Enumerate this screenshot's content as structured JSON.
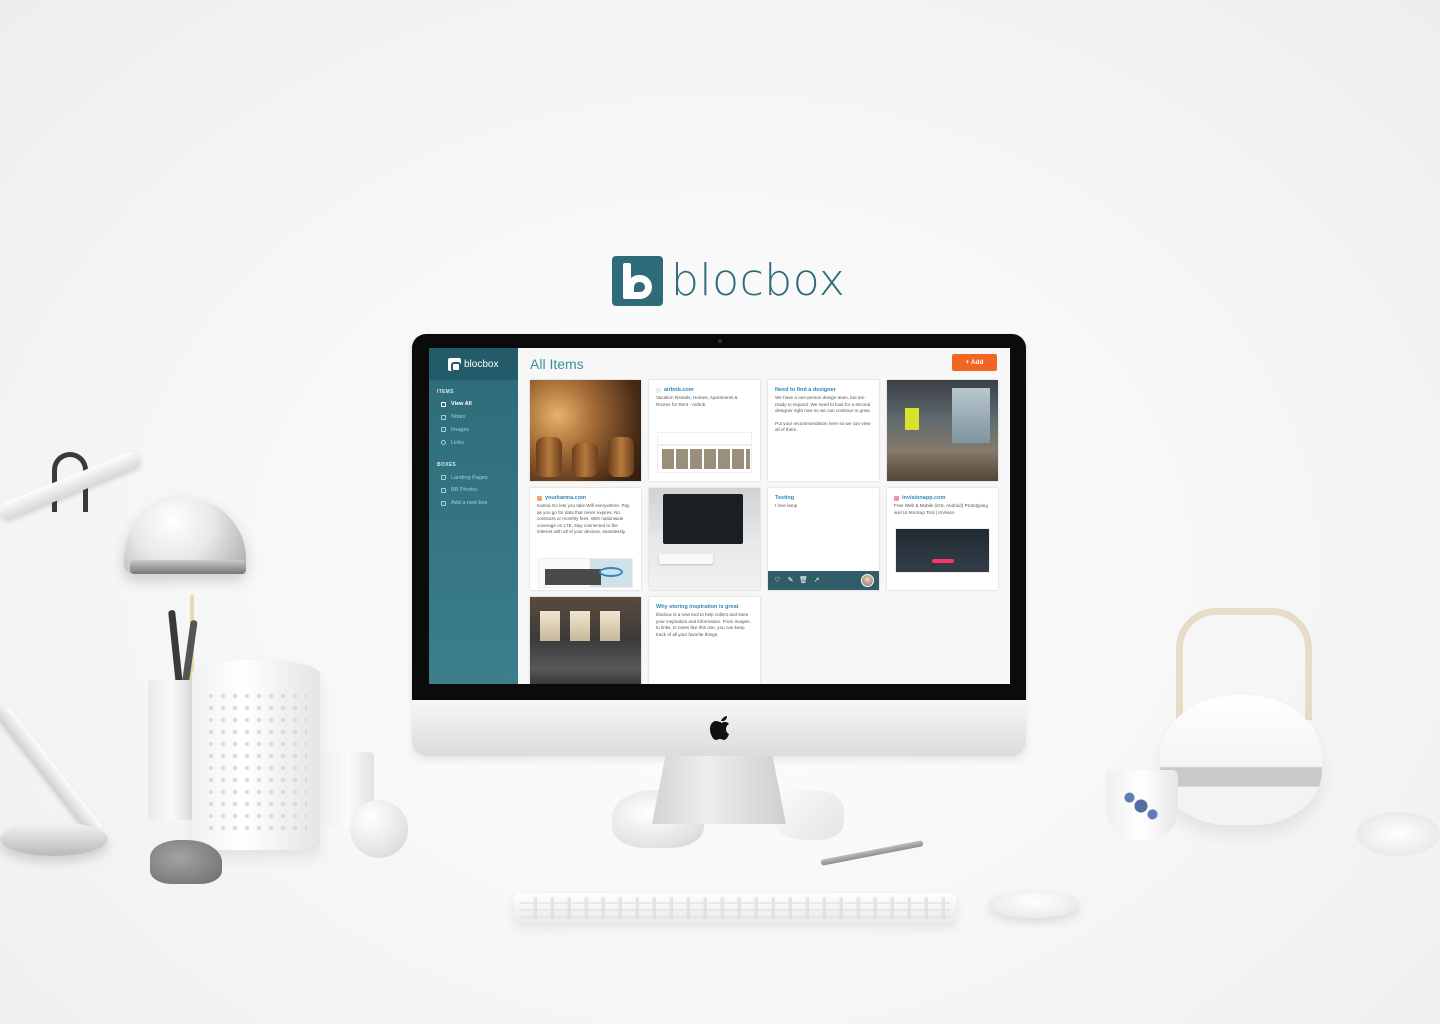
{
  "brand": {
    "name": "blocbox",
    "color": "#2f6c7a"
  },
  "app": {
    "sidebar": {
      "logo": "blocbox",
      "items_section": "ITEMS",
      "items": [
        {
          "label": "View All",
          "icon": "grid-icon",
          "active": true
        },
        {
          "label": "Notes",
          "icon": "note-icon"
        },
        {
          "label": "Images",
          "icon": "image-icon"
        },
        {
          "label": "Links",
          "icon": "link-icon"
        }
      ],
      "boxes_section": "BOXES",
      "boxes": [
        {
          "label": "Landing Pages",
          "icon": "box-icon"
        },
        {
          "label": "BB Photos",
          "icon": "box-icon"
        },
        {
          "label": "Add a new box",
          "icon": "plus-box-icon"
        }
      ]
    },
    "header": {
      "title": "All Items",
      "add_label": "+ Add",
      "accent": "#f26522"
    },
    "cards": [
      {
        "type": "image",
        "subject": "bar"
      },
      {
        "type": "link",
        "title": "airbnb.com",
        "body": "Vacation Rentals, Homes, Apartments & Rooms for Rent - Airbnb"
      },
      {
        "type": "note",
        "title": "Need to find a designer",
        "body": "We have a one-person design team, but are ready to expand. We need to look for a second designer right now so we can continue to grow.",
        "body2": "Put your recommendation here so we can view all of them."
      },
      {
        "type": "image",
        "subject": "office"
      },
      {
        "type": "link",
        "title": "yourkarma.com",
        "body": "Karma Go lets you take Wifi everywhere. Pay as you go for data that never expires. No contracts or monthly fees. With nationwide coverage on LTE, stay connected to the internet with all of your devices, seamlessly."
      },
      {
        "type": "image",
        "subject": "imac"
      },
      {
        "type": "note",
        "title": "Testing",
        "body": "I love lamp"
      },
      {
        "type": "link",
        "title": "invisionapp.com",
        "body": "Free Web & Mobile (iOS, Android) Prototyping and UI Mockup Tool | InVision"
      },
      {
        "type": "image",
        "subject": "loft"
      },
      {
        "type": "note",
        "title": "Why storing inspiration is great",
        "body": "blocbox is a new tool to help collect and store your inspiration and information. From images, to links, to notes like this one, you can keep track of all your favorite things."
      }
    ],
    "card_actions": [
      "heart-icon",
      "edit-icon",
      "trash-icon",
      "share-icon"
    ]
  },
  "colors": {
    "sidebar": "#2d6b78",
    "link_title": "#2a8ab5",
    "page_title": "#3a8fa0",
    "add_button": "#f26522"
  }
}
